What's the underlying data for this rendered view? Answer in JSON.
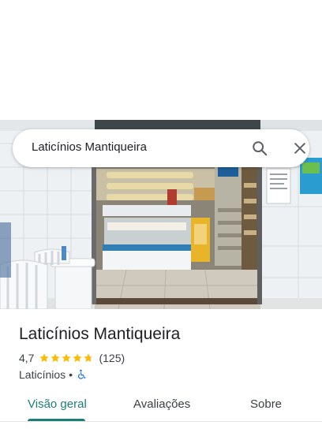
{
  "search": {
    "query": "Laticínios Mantiqueira"
  },
  "place": {
    "name": "Laticínios Mantiqueira",
    "rating": "4,7",
    "rating_value": 4.7,
    "review_count": "(125)",
    "category": "Laticínios",
    "separator": "•",
    "accessibility_icon": "wheelchair-icon"
  },
  "tabs": [
    {
      "label": "Visão geral",
      "selected": true
    },
    {
      "label": "Avaliações",
      "selected": false
    },
    {
      "label": "Sobre",
      "selected": false
    }
  ],
  "colors": {
    "accent": "#1a7f78",
    "star": "#fbbc04",
    "wheelchair": "#1a73e8"
  },
  "icons": {
    "search": "search-icon",
    "close": "close-icon",
    "star": "star-icon"
  }
}
